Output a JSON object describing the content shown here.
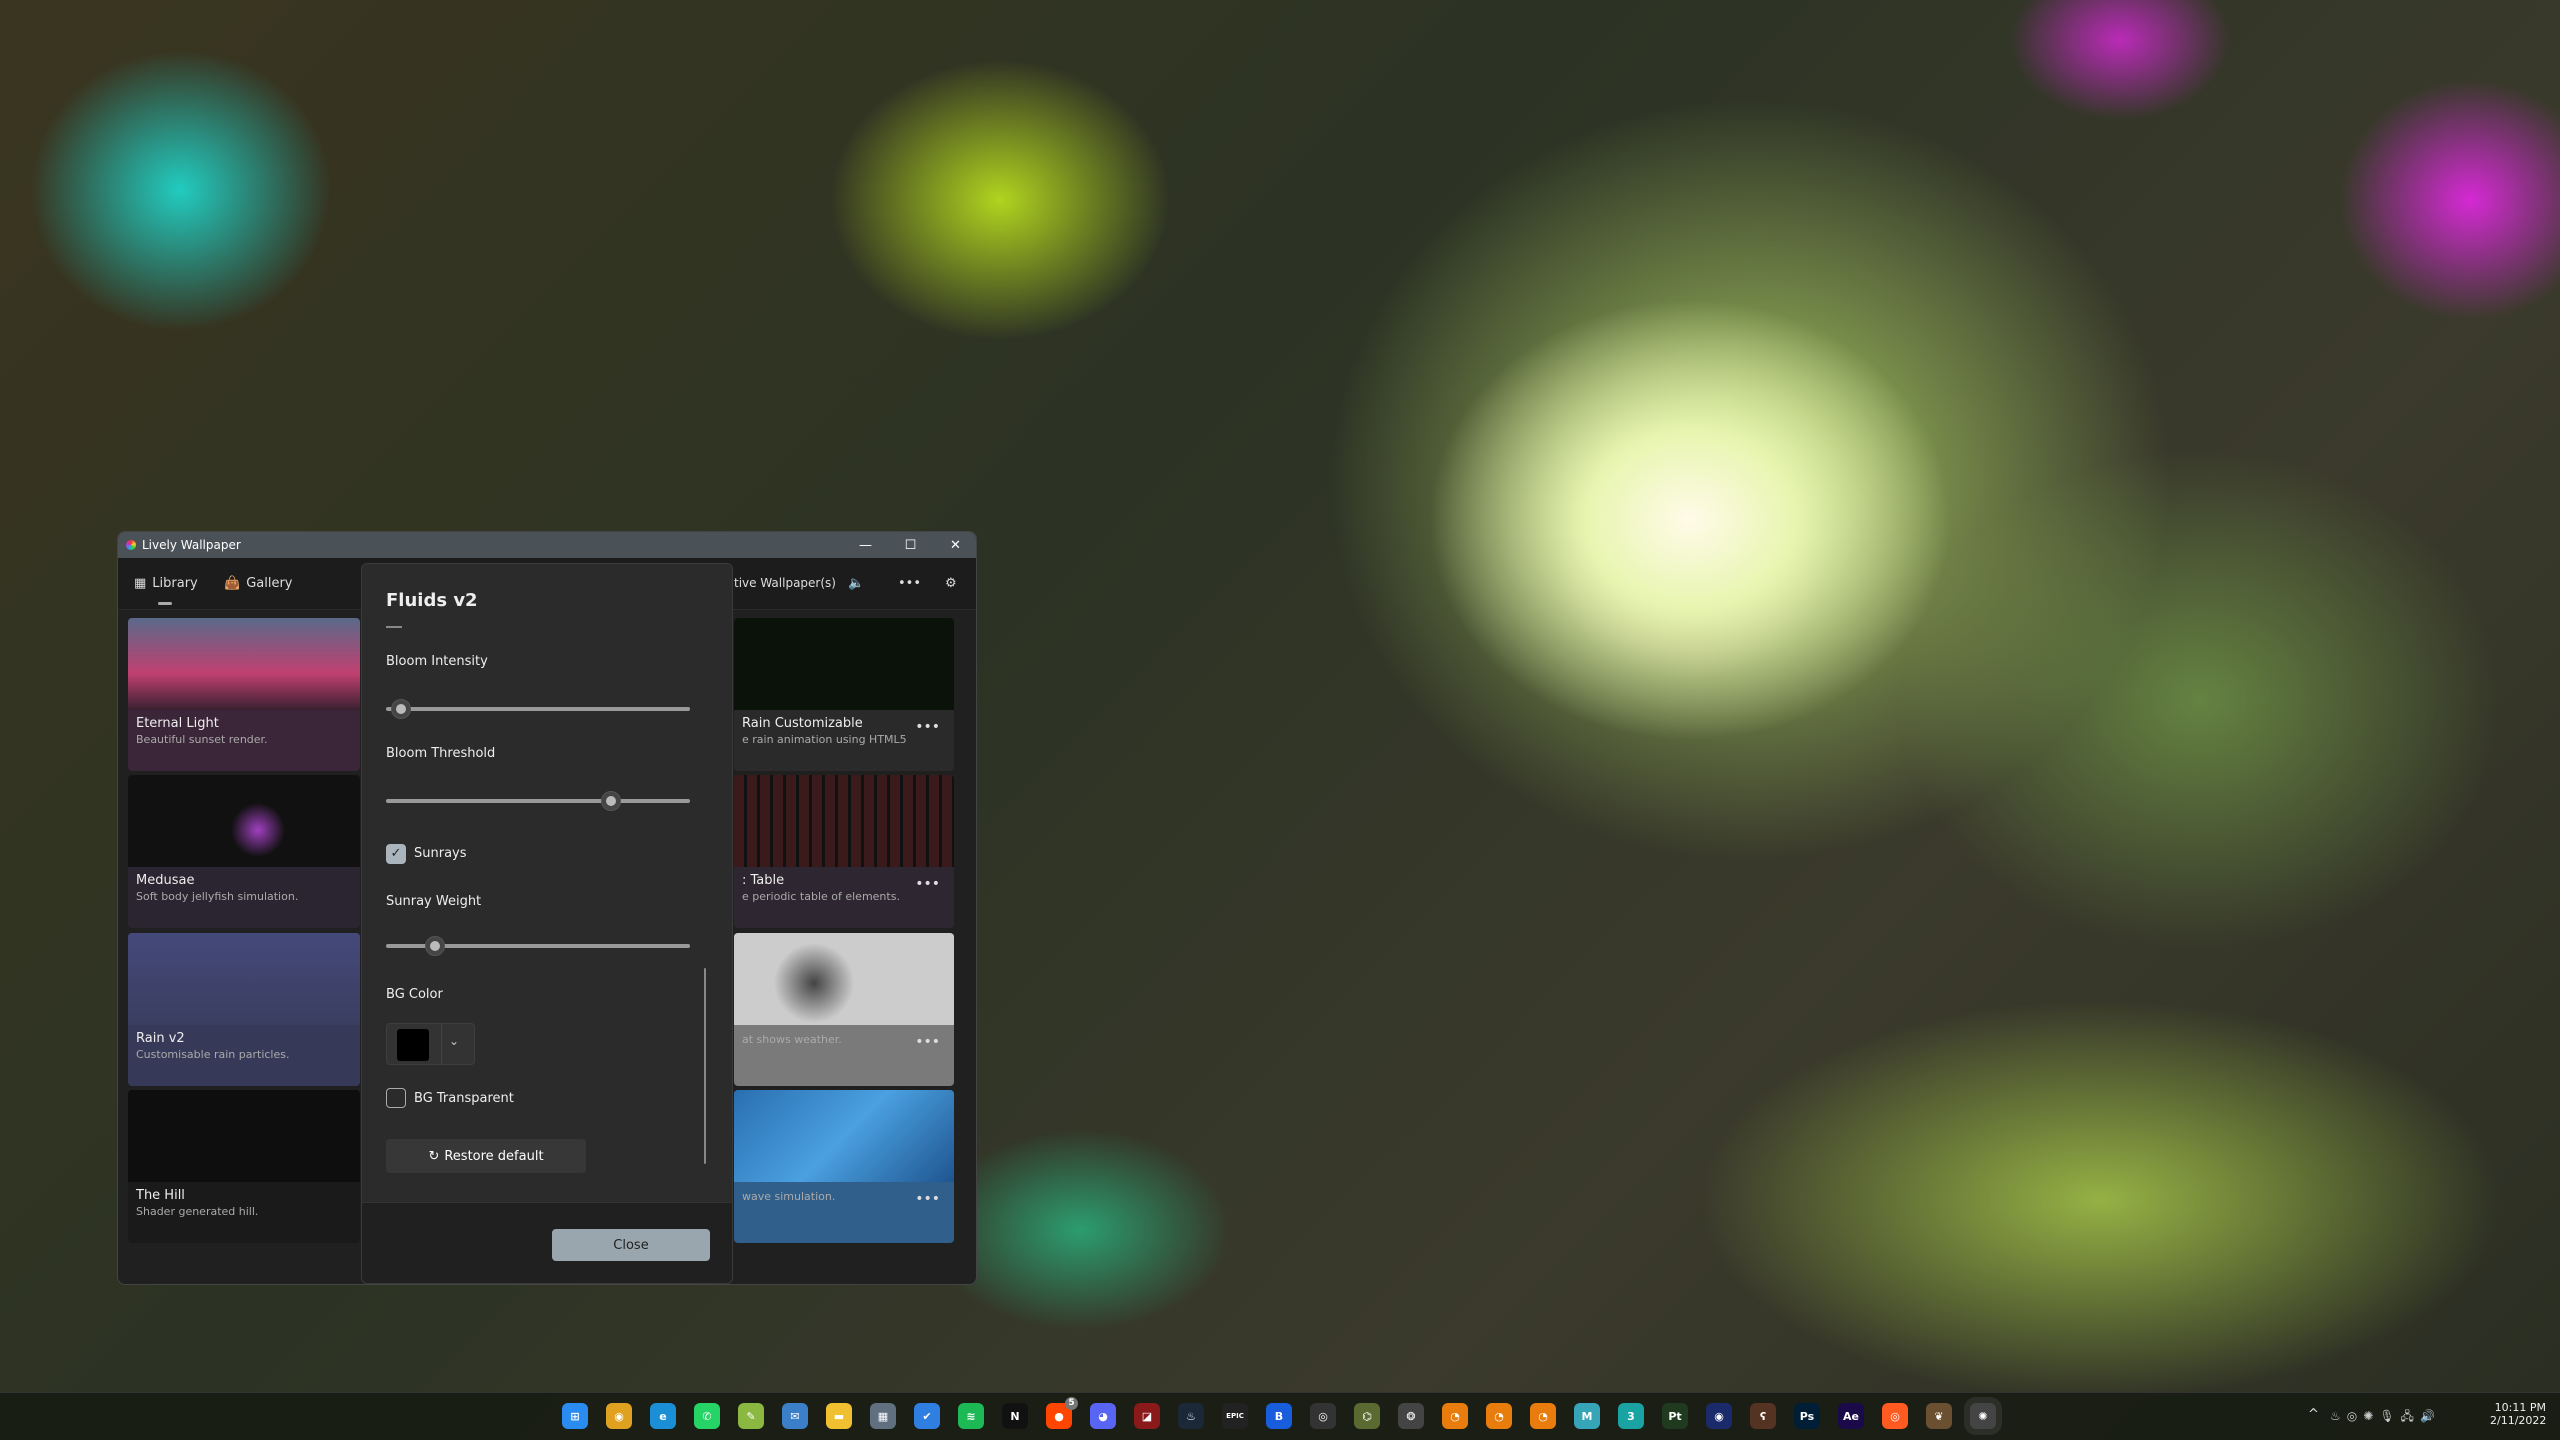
{
  "window": {
    "title": "Lively Wallpaper",
    "minimize": "—",
    "maximize": "☐",
    "close": "✕"
  },
  "nav": {
    "library": "Library",
    "gallery": "Gallery",
    "active_wallpapers": "tive Wallpaper(s)",
    "more": "•••"
  },
  "library": [
    {
      "title": "Eternal Light",
      "desc": "Beautiful sunset render."
    },
    {
      "title": "Medusae",
      "desc": "Soft body jellyfish simulation."
    },
    {
      "title": "Rain v2",
      "desc": "Customisable rain particles."
    },
    {
      "title": "The Hill",
      "desc": "Shader generated hill."
    }
  ],
  "library_right": [
    {
      "title": "Rain Customizable",
      "desc": "e rain animation using HTML5"
    },
    {
      "title": ": Table",
      "desc": "e periodic table of elements."
    },
    {
      "title": "",
      "desc": "at shows weather."
    },
    {
      "title": "",
      "desc": "wave simulation."
    }
  ],
  "dialog": {
    "title": "Fluids v2",
    "bloom_intensity": {
      "label": "Bloom Intensity",
      "value": 0.05
    },
    "bloom_threshold": {
      "label": "Bloom Threshold",
      "value": 0.74
    },
    "sunrays": {
      "label": "Sunrays",
      "checked": true
    },
    "sunray_weight": {
      "label": "Sunray Weight",
      "value": 0.16
    },
    "bg_color": {
      "label": "BG Color",
      "value": "#000000"
    },
    "bg_transparent": {
      "label": "BG Transparent",
      "checked": false
    },
    "restore": "Restore default",
    "close": "Close"
  },
  "taskbar": {
    "icons": [
      {
        "name": "start",
        "c": "#2a8cf0",
        "t": "⊞"
      },
      {
        "name": "chrome",
        "c": "#e0a020",
        "t": "◉"
      },
      {
        "name": "edge",
        "c": "#1a8fd6",
        "t": "e"
      },
      {
        "name": "whatsapp",
        "c": "#25d366",
        "t": "✆"
      },
      {
        "name": "notepad",
        "c": "#8bb840",
        "t": "✎"
      },
      {
        "name": "mail",
        "c": "#3a7fc8",
        "t": "✉"
      },
      {
        "name": "file-explorer",
        "c": "#f0c030",
        "t": "▬"
      },
      {
        "name": "calculator",
        "c": "#607080",
        "t": "▦"
      },
      {
        "name": "todo",
        "c": "#2f7fe0",
        "t": "✔"
      },
      {
        "name": "spotify",
        "c": "#1db954",
        "t": "≋"
      },
      {
        "name": "netflix",
        "c": "#111",
        "t": "N"
      },
      {
        "name": "reddit",
        "c": "#ff4500",
        "t": "●",
        "badge": "5"
      },
      {
        "name": "discord",
        "c": "#5865f2",
        "t": "◕"
      },
      {
        "name": "dota",
        "c": "#8a1a1a",
        "t": "◪"
      },
      {
        "name": "steam",
        "c": "#1b2838",
        "t": "♨"
      },
      {
        "name": "epic-games",
        "c": "#222",
        "t": "EPIC"
      },
      {
        "name": "bitwarden",
        "c": "#175ddc",
        "t": "B"
      },
      {
        "name": "obs",
        "c": "#333",
        "t": "◎"
      },
      {
        "name": "app-green",
        "c": "#5a6a30",
        "t": "⌬"
      },
      {
        "name": "davinci",
        "c": "#444",
        "t": "❂"
      },
      {
        "name": "blender",
        "c": "#e87d0d",
        "t": "◔"
      },
      {
        "name": "blender-2",
        "c": "#e87d0d",
        "t": "◔"
      },
      {
        "name": "blender-3",
        "c": "#e87d0d",
        "t": "◔"
      },
      {
        "name": "maya",
        "c": "#37a5b8",
        "t": "M"
      },
      {
        "name": "3ds-max",
        "c": "#1aa3a3",
        "t": "3"
      },
      {
        "name": "substance-painter",
        "c": "#1f3a1f",
        "t": "Pt"
      },
      {
        "name": "cinema4d",
        "c": "#1a2a6a",
        "t": "◉"
      },
      {
        "name": "app-orange",
        "c": "#553322",
        "t": "ʕ"
      },
      {
        "name": "photoshop",
        "c": "#001e36",
        "t": "Ps"
      },
      {
        "name": "after-effects",
        "c": "#1a0a4a",
        "t": "Ae"
      },
      {
        "name": "houdini",
        "c": "#ff5a1f",
        "t": "◎"
      },
      {
        "name": "app-flame",
        "c": "#6a5030",
        "t": "❦"
      },
      {
        "name": "lively",
        "c": "#444",
        "t": "✺"
      }
    ],
    "tray": {
      "chevron": "^",
      "time": "10:11 PM",
      "date": "2/11/2022"
    }
  }
}
